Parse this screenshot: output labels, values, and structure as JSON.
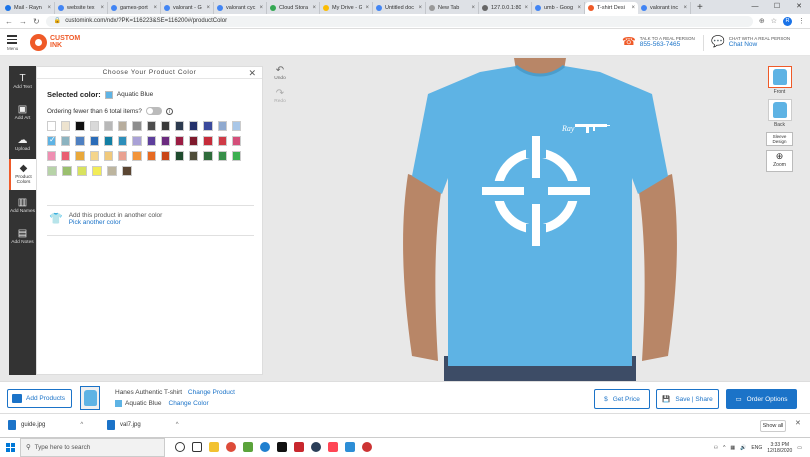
{
  "browser": {
    "tabs": [
      {
        "label": "Mail - Rayn",
        "color": "#1a73e8"
      },
      {
        "label": "website tex",
        "color": "#4285f4"
      },
      {
        "label": "games-port",
        "color": "#4285f4"
      },
      {
        "label": "valorant - G",
        "color": "#4285f4"
      },
      {
        "label": "valorant cyc",
        "color": "#4285f4"
      },
      {
        "label": "Cloud Stora",
        "color": "#34a853"
      },
      {
        "label": "My Drive - G",
        "color": "#fbbc04"
      },
      {
        "label": "Untitled doc",
        "color": "#4285f4"
      },
      {
        "label": "New Tab",
        "color": "#999999"
      },
      {
        "label": "127.0.0.1:80",
        "color": "#666666"
      },
      {
        "label": "umb - Goog",
        "color": "#4285f4"
      },
      {
        "label": "T-shirt Desi",
        "color": "#ef5a28",
        "active": true
      },
      {
        "label": "valorant inc",
        "color": "#4285f4"
      }
    ],
    "url": "customink.com/ndx/?PK=116223&SE=116200#/productColor",
    "profile_initial": "R"
  },
  "header": {
    "menu_label": "Menu",
    "logo_line1": "CUSTOM",
    "logo_line2": "INK",
    "talk_label": "TALK TO A REAL PERSON",
    "phone": "855-563-7465",
    "chat_label": "CHAT WITH A REAL PERSON",
    "chat_link": "Chat Now"
  },
  "left_tools": [
    {
      "icon": "T",
      "label": "Add Text"
    },
    {
      "icon": "▣",
      "label": "Add Art"
    },
    {
      "icon": "☁",
      "label": "Upload"
    },
    {
      "icon": "◆",
      "label": "Product Colors",
      "active": true
    },
    {
      "icon": "▥",
      "label": "Add Names"
    },
    {
      "icon": "▤",
      "label": "Add Notes"
    }
  ],
  "panel": {
    "title": "Choose Your Product Color",
    "selected_label": "Selected color:",
    "selected_color_name": "Aquatic Blue",
    "selected_color_hex": "#5eb3e4",
    "ordering_text": "Ordering fewer than 6 total items?",
    "another_text": "Add this product in another color",
    "another_link": "Pick another color"
  },
  "swatch_rows": [
    [
      "#ffffff",
      "#ede3cf",
      "#111111",
      "#d9d9d9",
      "#b8b8b8",
      "#b7ad9d",
      "#8d8d8d",
      "#4d4d4d",
      "#3a3a3a",
      "#2d3b4f",
      "#24316b",
      "#3b4a9c",
      "#8fa9cf",
      "#a9c7e8"
    ],
    [
      "#5eb3e4",
      "#8cb3c0",
      "#4f80c1",
      "#2b6cb8",
      "#127fa4",
      "#2d8fbb",
      "#a9a1d6",
      "#5d3e9c",
      "#6b2b7f",
      "#9b1d43",
      "#7f1a2c",
      "#c52c3a",
      "#cf3b47",
      "#d44f7a"
    ],
    [
      "#ef8fb2",
      "#e95f72",
      "#e9a83a",
      "#f4d58c",
      "#f0c97c",
      "#e9a191",
      "#f2943a",
      "#e66a22",
      "#c94518",
      "#1f4b2e",
      "#4f4d39",
      "#2f6b3b",
      "#378f48",
      "#3bb050"
    ],
    [
      "#b7d3a8",
      "#9abf6e",
      "#d8e25f",
      "#f2ec58",
      "#bdb59f",
      "#5b4633"
    ]
  ],
  "canvas_tools": {
    "undo": "Undo",
    "redo": "Redo"
  },
  "views": [
    {
      "label": "Front",
      "active": true
    },
    {
      "label": "Back"
    }
  ],
  "sleeve_label": "Sleeve Design",
  "zoom_label": "Zoom",
  "design": {
    "tee_color": "#5eb3e4",
    "text": "Ray"
  },
  "bottom": {
    "add_products": "Add Products",
    "product_name": "Hanes Authentic T-shirt",
    "change_product": "Change Product",
    "color_name": "Aquatic Blue",
    "change_color": "Change Color",
    "get_price": "Get Price",
    "save_share": "Save | Share",
    "order_options": "Order Options"
  },
  "downloads": [
    {
      "name": "guide.jpg"
    },
    {
      "name": "val7.jpg"
    }
  ],
  "show_all": "Show all",
  "taskbar": {
    "search_placeholder": "Type here to search",
    "time": "3:33 PM",
    "date": "12/18/2020",
    "lang": "ENG"
  }
}
